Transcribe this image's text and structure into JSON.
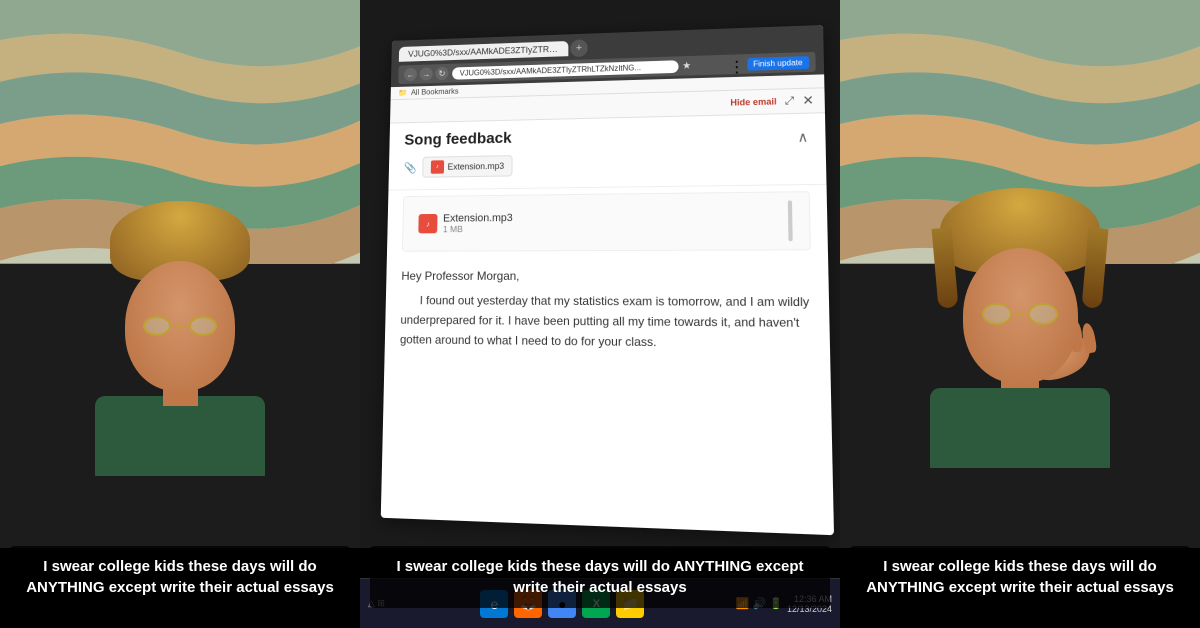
{
  "panels": {
    "left": {
      "caption": "I swear college kids these days will do ANYTHING except write their actual essays"
    },
    "middle": {
      "caption": "I swear college kids these days will do ANYTHING except write their actual essays",
      "browser": {
        "address_bar": "VJUG0%3D/sxx/AAMkADE3ZTIyZTRhLTZkNzItNG...",
        "finish_update": "Finish update",
        "bookmarks": "All Bookmarks",
        "toolbar_hide": "Hide email",
        "subject": "Song feedback",
        "attachment_chip_name": "Extension.mp3",
        "attachment_file_name": "Extension.mp3",
        "attachment_file_size": "1 MB",
        "greeting": "Hey Professor Morgan,",
        "body": "I found out yesterday that my statistics exam is tomorrow, and I am wildly underprepared for it. I have been putting all my time towards it, and  haven't gotten around to what I need to do for your class.",
        "collapse_icon": "∧"
      },
      "taskbar": {
        "time": "12:36 AM",
        "date": "12/13/2024"
      }
    },
    "right": {
      "caption": "I swear college kids these days will do ANYTHING except write their actual essays"
    }
  }
}
